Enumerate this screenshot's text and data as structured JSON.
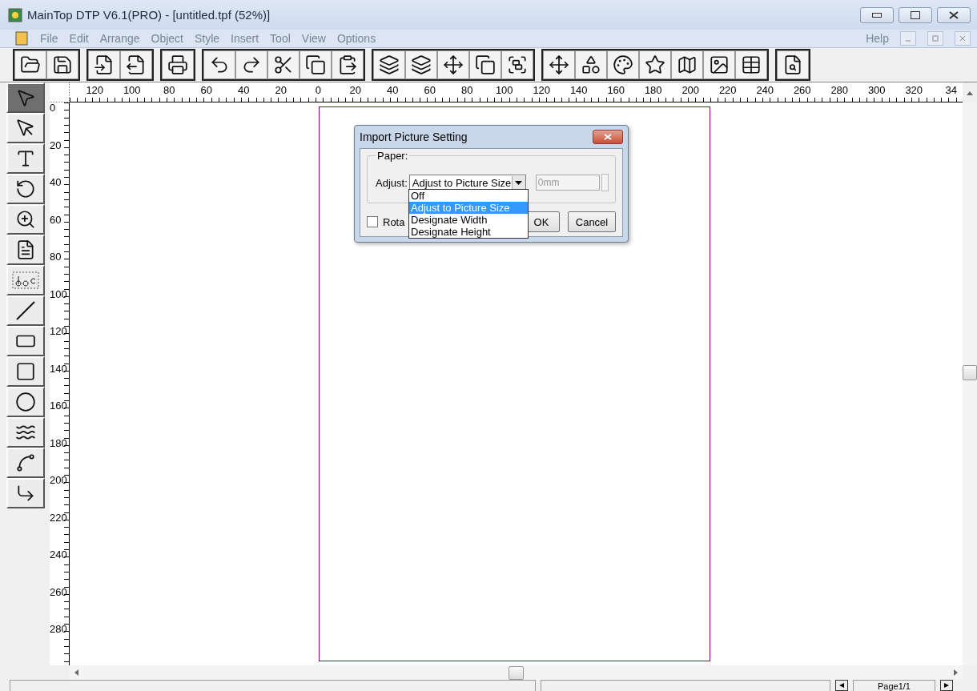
{
  "window": {
    "title": "MainTop DTP V6.1(PRO) - [untitled.tpf (52%)]"
  },
  "menu": {
    "items": [
      "File",
      "Edit",
      "Arrange",
      "Object",
      "Style",
      "Insert",
      "Tool",
      "View",
      "Options"
    ],
    "help": "Help"
  },
  "tools": [
    {
      "selected": true
    },
    {
      "selected": false
    },
    {
      "selected": false
    },
    {
      "selected": false
    },
    {
      "selected": false
    },
    {
      "selected": false
    },
    {
      "selected": false
    },
    {
      "selected": false
    },
    {
      "selected": false
    },
    {
      "selected": false
    },
    {
      "selected": false
    },
    {
      "selected": false
    },
    {
      "selected": false
    },
    {
      "selected": false
    }
  ],
  "ruler": {
    "horizontal": [
      "120",
      "100",
      "80",
      "60",
      "40",
      "20",
      "0",
      "20",
      "40",
      "60",
      "80",
      "100",
      "120",
      "140",
      "160",
      "180",
      "200",
      "220",
      "240",
      "260",
      "280",
      "300",
      "320",
      "34"
    ],
    "vertical": [
      "0",
      "20",
      "40",
      "60",
      "80",
      "100",
      "120",
      "140",
      "160",
      "180",
      "200",
      "220",
      "240",
      "260",
      "280"
    ]
  },
  "dialog": {
    "title": "Import Picture Setting",
    "group_label": "Paper:",
    "adjust_label": "Adjust:",
    "select_value": "Adjust to Picture Size",
    "size_value": "0mm",
    "size_disabled": true,
    "options": [
      {
        "label": "Off",
        "selected": false
      },
      {
        "label": "Adjust to Picture Size",
        "selected": true
      },
      {
        "label": "Designate Width",
        "selected": false
      },
      {
        "label": "Designate Height",
        "selected": false
      }
    ],
    "rotate": {
      "label": "Rota",
      "checked": false
    },
    "buttons": [
      "OK",
      "Cancel"
    ]
  },
  "status_bar": {
    "page": "Page1/1"
  }
}
